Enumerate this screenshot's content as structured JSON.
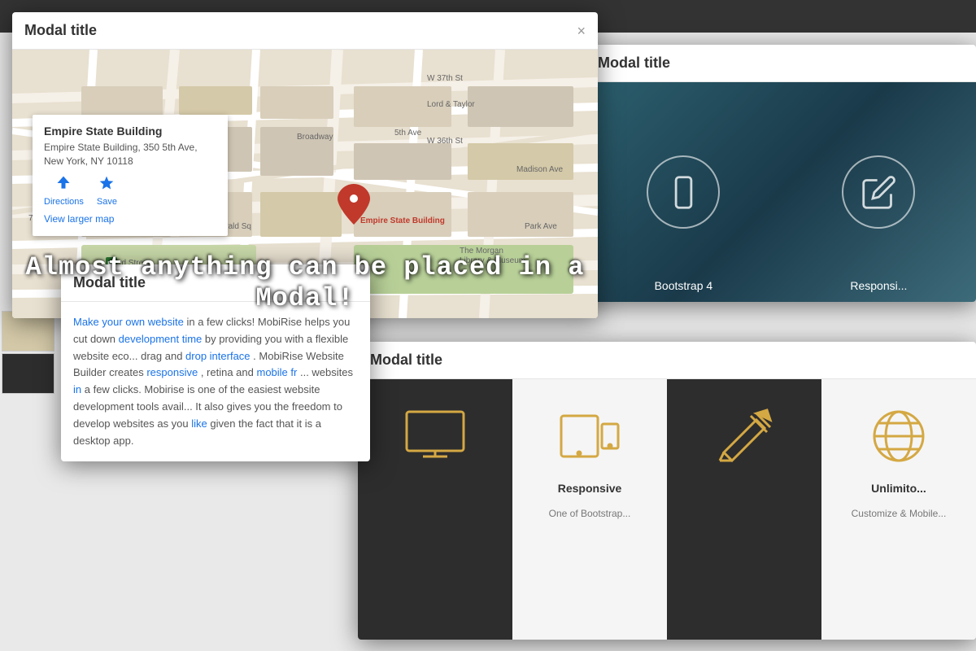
{
  "modal_map": {
    "title": "Modal title",
    "close_label": "×",
    "map_place": {
      "name": "Empire State Building",
      "address": "Empire State Building, 350 5th Ave, New York, NY 10118",
      "directions_label": "Directions",
      "save_label": "Save",
      "view_map_label": "View larger map"
    }
  },
  "modal_bootstrap": {
    "title": "Modal title",
    "caption1": "Bootstrap 4",
    "caption2": "Responsi..."
  },
  "modal_text": {
    "title": "Modal title",
    "body": "Make your own website in a few clicks! MobiRise helps you cut down development time by providing you with a flexible website eco... drag and drop interface. MobiRise Website Builder creates responsive, retina and mobile friendly websites in a few clicks. Mobirise is one of the easiest website development tools avail... It also gives you the freedom to develop websites as you like given the fact that it is a desktop app."
  },
  "modal_icons": {
    "title": "Modal title",
    "cards": [
      {
        "id": "monitor",
        "label": "",
        "bg": "dark"
      },
      {
        "id": "responsive",
        "label": "Responsive",
        "bg": "light",
        "sublabel": "One of Bootstrap..."
      },
      {
        "id": "edit",
        "label": "",
        "bg": "dark"
      },
      {
        "id": "globe",
        "label": "Unlimito...",
        "bg": "light"
      }
    ]
  },
  "overlay_text": "Almost anything can be placed in a Modal!",
  "colors": {
    "modal_bg": "#ffffff",
    "dark_card": "#2d2d2d",
    "icon_gold": "#d4a843",
    "link_blue": "#1a73e8",
    "accent_teal": "#2c5f6e"
  }
}
